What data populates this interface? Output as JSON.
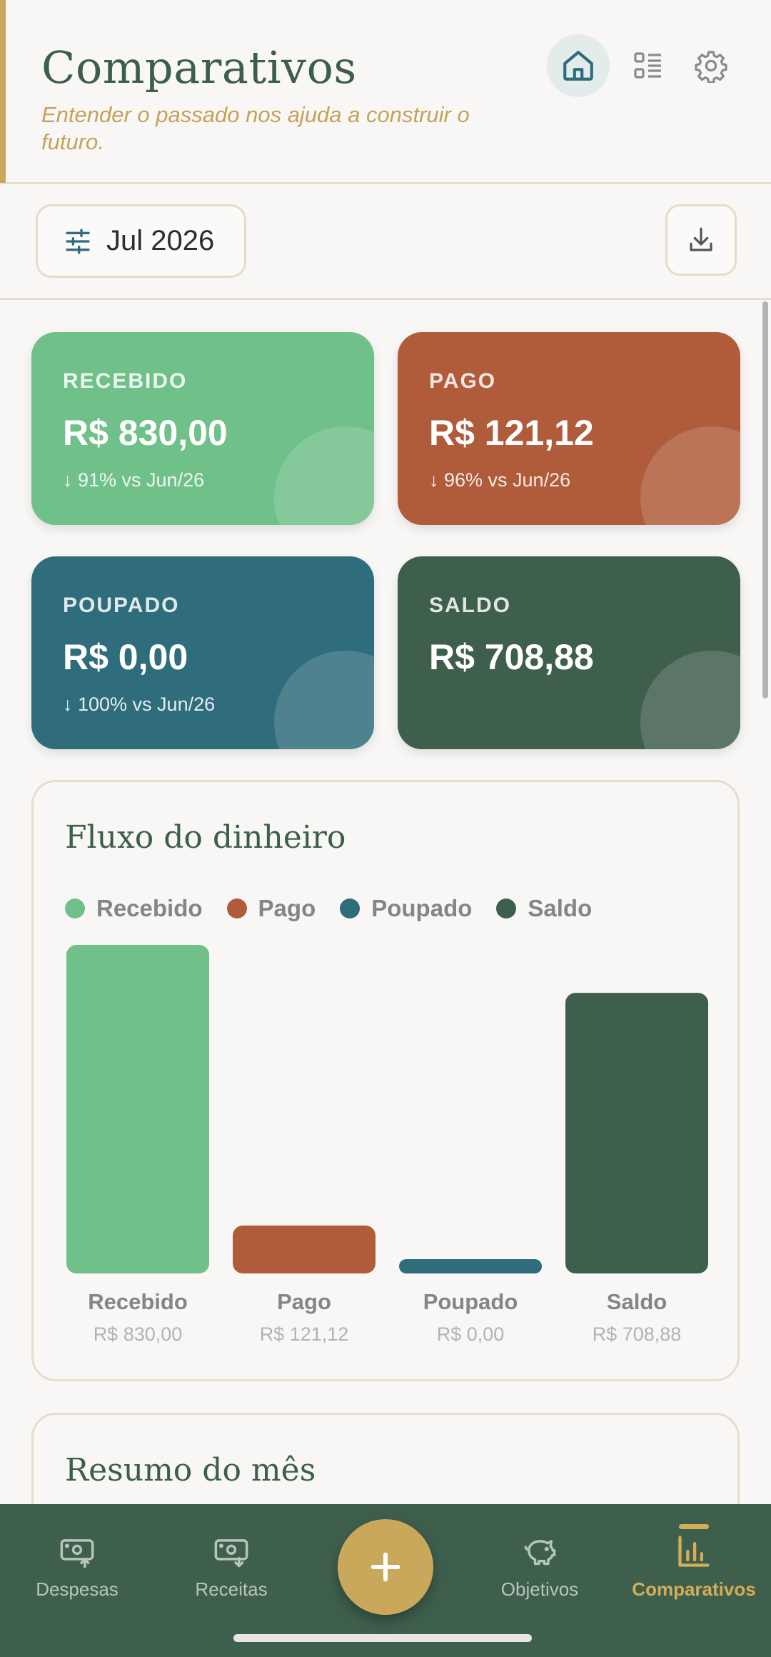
{
  "header": {
    "title": "Comparativos",
    "subtitle": "Entender o passado nos ajuda a construir o futuro.",
    "icons": [
      "home-icon",
      "list-icon",
      "gear-icon"
    ]
  },
  "toolbar": {
    "period_label": "Jul 2026",
    "filter_icon": "sliders-icon",
    "download_icon": "download-icon"
  },
  "cards": [
    {
      "key": "received",
      "label": "RECEBIDO",
      "value": "R$ 830,00",
      "delta": "↓ 91% vs Jun/26",
      "color": "#70c08a"
    },
    {
      "key": "paid",
      "label": "PAGO",
      "value": "R$ 121,12",
      "delta": "↓ 96% vs Jun/26",
      "color": "#b05c3b"
    },
    {
      "key": "saved",
      "label": "POUPADO",
      "value": "R$ 0,00",
      "delta": "↓ 100% vs Jun/26",
      "color": "#2f6d7c"
    },
    {
      "key": "balance",
      "label": "SALDO",
      "value": "R$ 708,88",
      "delta": "",
      "color": "#3f5f4d"
    }
  ],
  "flow_panel": {
    "title": "Fluxo do dinheiro"
  },
  "summary_panel": {
    "title": "Resumo do mês"
  },
  "chart_data": {
    "type": "bar",
    "title": "Fluxo do dinheiro",
    "categories": [
      "Recebido",
      "Pago",
      "Poupado",
      "Saldo"
    ],
    "values": [
      830.0,
      121.12,
      0.0,
      708.88
    ],
    "value_labels": [
      "R$ 830,00",
      "R$ 121,12",
      "R$ 0,00",
      "R$ 708,88"
    ],
    "colors": [
      "#70c08a",
      "#b05c3b",
      "#2f6d7c",
      "#3f5f4d"
    ],
    "legend": [
      "Recebido",
      "Pago",
      "Poupado",
      "Saldo"
    ],
    "legend_position": "top-left",
    "grid": false,
    "ylim": [
      0,
      830
    ]
  },
  "bottom_nav": {
    "items": [
      {
        "label": "Despesas",
        "icon": "money-out-icon"
      },
      {
        "label": "Receitas",
        "icon": "money-in-icon"
      },
      {
        "label": "Objetivos",
        "icon": "piggy-bank-icon"
      },
      {
        "label": "Comparativos",
        "icon": "bar-chart-icon"
      }
    ],
    "fab_icon": "plus-icon",
    "active": "Comparativos"
  }
}
